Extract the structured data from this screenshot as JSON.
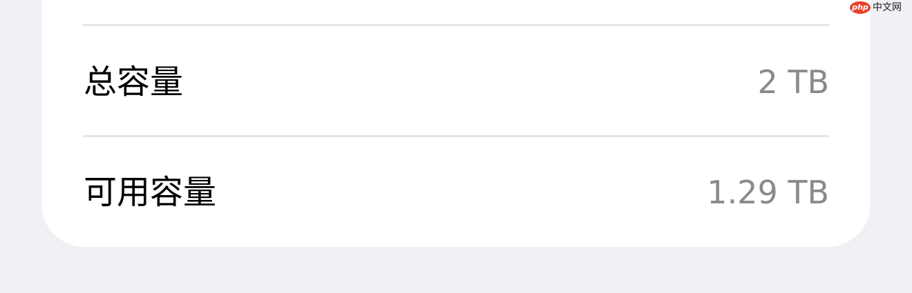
{
  "storage": {
    "rows": [
      {
        "label": "总容量",
        "value": "2 TB"
      },
      {
        "label": "可用容量",
        "value": "1.29 TB"
      }
    ]
  },
  "watermark": {
    "logo": "php",
    "text": "中文网"
  },
  "colors": {
    "page_background": "#f0f0f5",
    "card_background": "#ffffff",
    "label_text": "#000000",
    "value_text": "#8a8a8e",
    "divider": "#e4e4e9",
    "watermark_logo": "#e8432c"
  }
}
